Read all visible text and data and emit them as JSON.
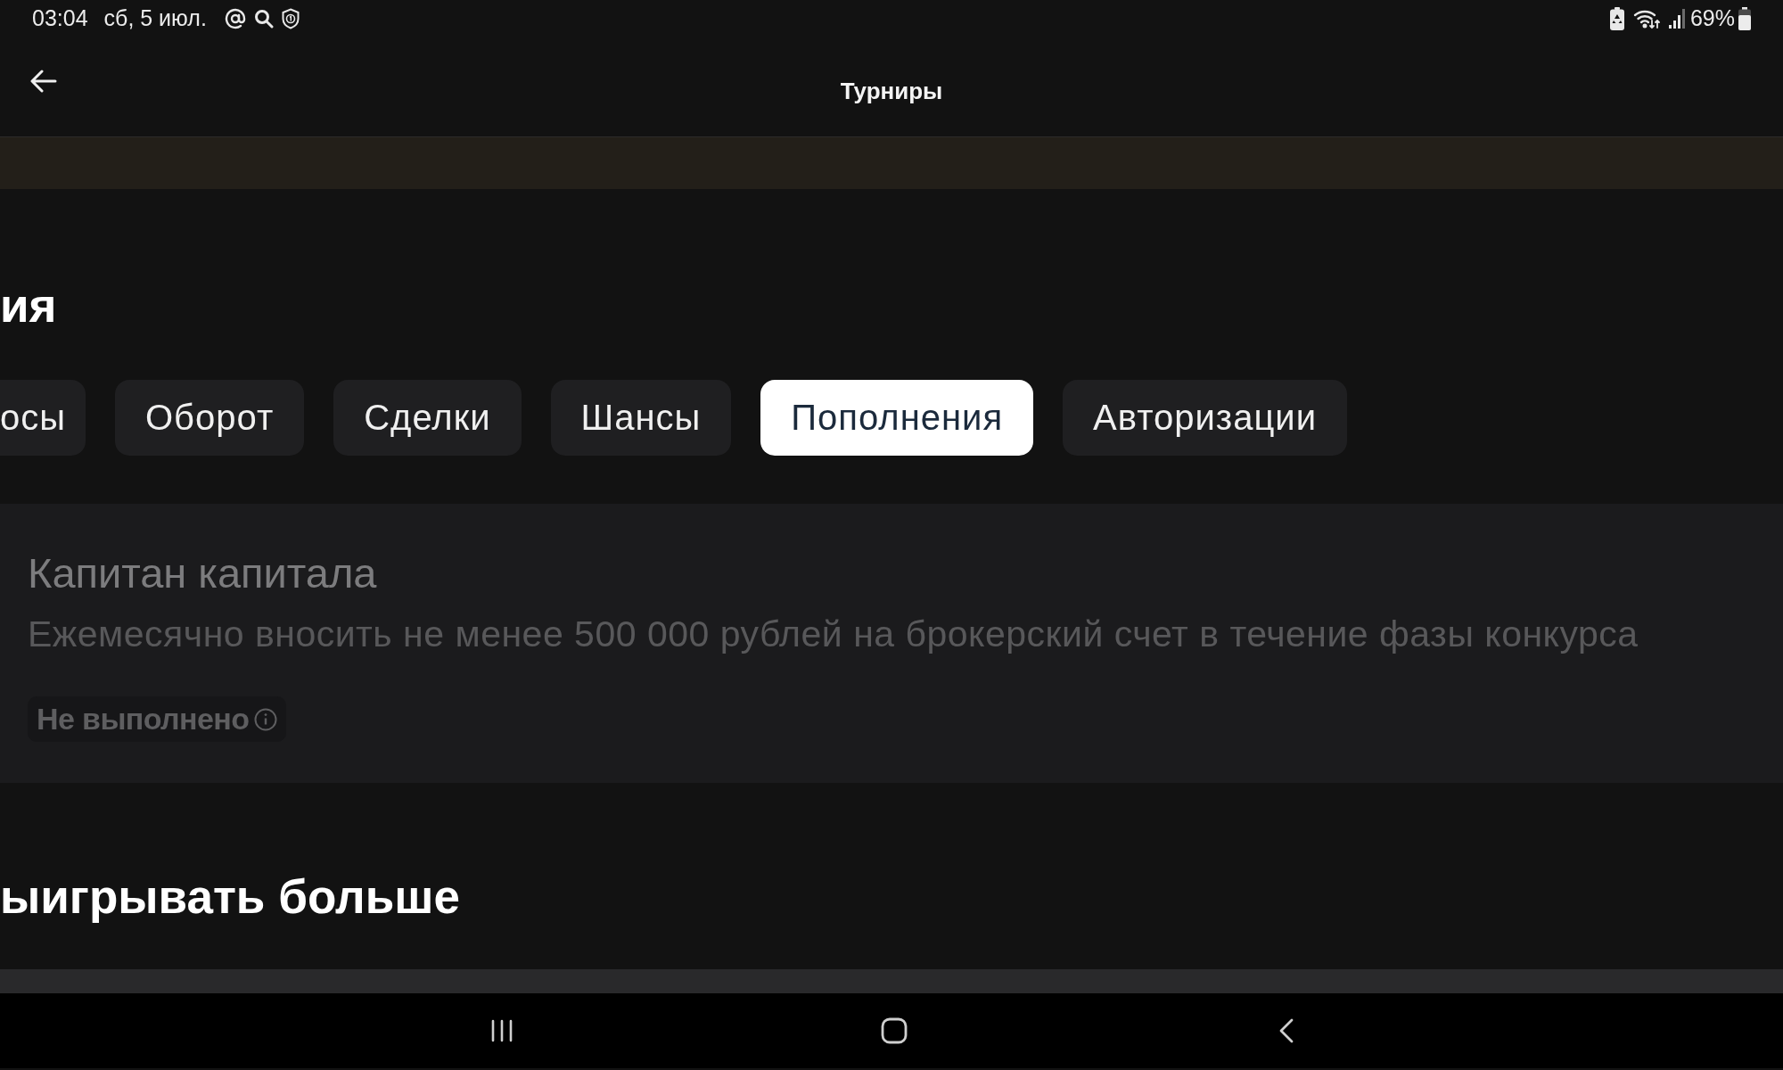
{
  "status_bar": {
    "time": "03:04",
    "date": "сб, 5 июл.",
    "battery": "69%"
  },
  "header": {
    "title": "Турниры"
  },
  "section": {
    "heading": "ия"
  },
  "tabs": [
    {
      "label": "осы",
      "selected": false
    },
    {
      "label": "Оборот",
      "selected": false
    },
    {
      "label": "Сделки",
      "selected": false
    },
    {
      "label": "Шансы",
      "selected": false
    },
    {
      "label": "Пополнения",
      "selected": true
    },
    {
      "label": "Авторизации",
      "selected": false
    }
  ],
  "task_card": {
    "title": "Капитан капитала",
    "description": "Ежемесячно вносить не менее 500 000 рублей на брокерский счет в течение фазы конкурса",
    "status": "Не выполнено"
  },
  "next_section": {
    "heading": "ыигрывать больше"
  }
}
